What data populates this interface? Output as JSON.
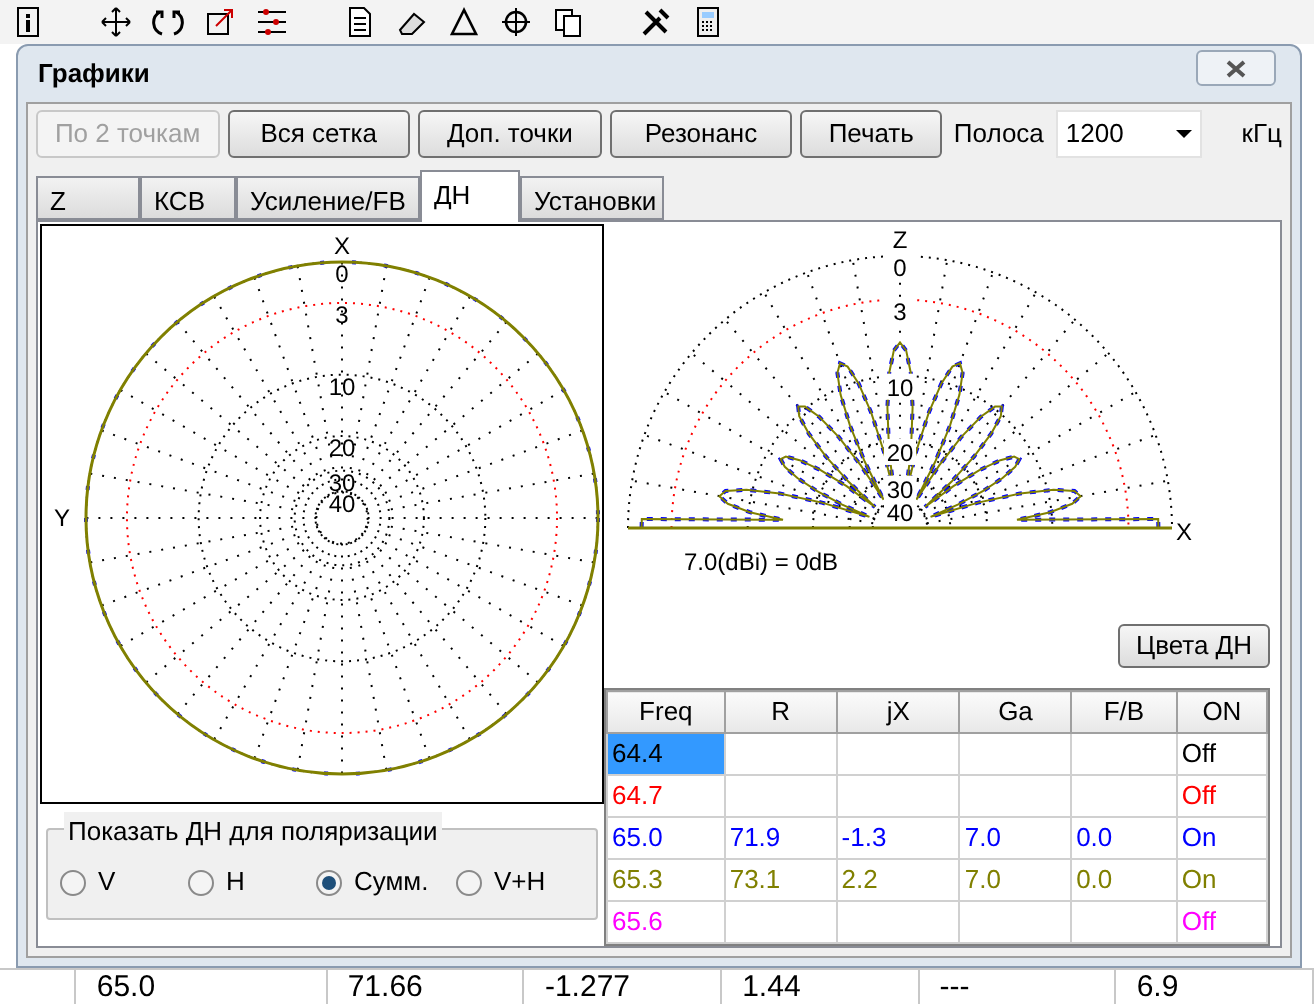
{
  "window": {
    "title": "Графики"
  },
  "buttons": [
    {
      "label": "По 2 точкам",
      "disabled": true
    },
    {
      "label": "Вся сетка",
      "disabled": false
    },
    {
      "label": "Доп. точки",
      "disabled": false
    },
    {
      "label": "Резонанс",
      "disabled": false
    },
    {
      "label": "Печать",
      "disabled": false
    }
  ],
  "band": {
    "label": "Полоса",
    "value": "1200",
    "unit": "кГц"
  },
  "tabs": [
    {
      "label": "Z",
      "selected": false
    },
    {
      "label": "КСВ",
      "selected": false
    },
    {
      "label": "Усиление/FB",
      "selected": false
    },
    {
      "label": "ДН",
      "selected": true
    },
    {
      "label": "Установки",
      "selected": false
    }
  ],
  "pattern_left": {
    "axis_top": "X",
    "axis_side": "Y",
    "ring_labels": [
      "0",
      "3",
      "10",
      "20",
      "30",
      "40"
    ]
  },
  "pattern_right": {
    "axis_top": "Z",
    "axis_side": "X",
    "ring_labels": [
      "0",
      "3",
      "10",
      "20",
      "30",
      "40"
    ]
  },
  "reference_label": "7.0(dBi) = 0dB",
  "colors_button": "Цвета ДН",
  "table": {
    "columns": [
      "Freq",
      "R",
      "jX",
      "Ga",
      "F/B",
      "ON"
    ],
    "rows": [
      {
        "color": "#000000",
        "selected": true,
        "freq": "64.4",
        "on": "Off"
      },
      {
        "color": "#ff0000",
        "selected": false,
        "freq": "64.7",
        "on": "Off"
      },
      {
        "color": "#0000ff",
        "selected": false,
        "freq": "65.0",
        "r": "71.9",
        "jx": "-1.3",
        "ga": "7.0",
        "fb": "0.0",
        "on": "On"
      },
      {
        "color": "#808000",
        "selected": false,
        "freq": "65.3",
        "r": "73.1",
        "jx": "2.2",
        "ga": "7.0",
        "fb": "0.0",
        "on": "On"
      },
      {
        "color": "#ff00ff",
        "selected": false,
        "freq": "65.6",
        "on": "Off"
      }
    ]
  },
  "polarization": {
    "title": "Показать ДН для поляризации",
    "options": [
      {
        "label": "V",
        "selected": false
      },
      {
        "label": "H",
        "selected": false
      },
      {
        "label": "Сумм.",
        "selected": true
      },
      {
        "label": "V+H",
        "selected": false
      }
    ]
  },
  "background_row": [
    "65.0",
    "71.66",
    "-1.277",
    "1.44",
    "---",
    "6.9"
  ]
}
